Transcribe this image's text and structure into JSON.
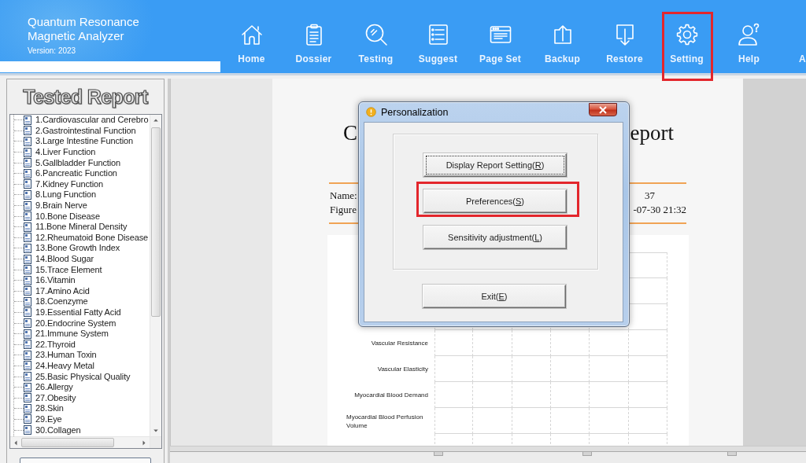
{
  "app": {
    "title_line_1": "Quantum Resonance",
    "title_line_2": "Magnetic Analyzer",
    "version": "Version: 2023"
  },
  "toolbar": [
    {
      "label": "Home",
      "highlighted": false
    },
    {
      "label": "Dossier",
      "highlighted": false
    },
    {
      "label": "Testing",
      "highlighted": false
    },
    {
      "label": "Suggest",
      "highlighted": false
    },
    {
      "label": "Page Set",
      "highlighted": false
    },
    {
      "label": "Backup",
      "highlighted": false
    },
    {
      "label": "Restore",
      "highlighted": false
    },
    {
      "label": "Setting",
      "highlighted": true
    },
    {
      "label": "Help",
      "highlighted": false
    },
    {
      "label": "A",
      "highlighted": false
    }
  ],
  "sidebar": {
    "heading": "Tested Report",
    "items": [
      {
        "label": "1.Cardiovascular and Cerebro",
        "selected": false
      },
      {
        "label": "2.Gastrointestinal Function",
        "selected": false
      },
      {
        "label": "3.Large Intestine Function",
        "selected": false
      },
      {
        "label": "4.Liver Function",
        "selected": false
      },
      {
        "label": "5.Gallbladder Function",
        "selected": false
      },
      {
        "label": "6.Pancreatic Function",
        "selected": false
      },
      {
        "label": "7.Kidney Function",
        "selected": false
      },
      {
        "label": "8.Lung Function",
        "selected": false
      },
      {
        "label": "9.Brain Nerve",
        "selected": false
      },
      {
        "label": "10.Bone Disease",
        "selected": false
      },
      {
        "label": "11.Bone Mineral Density",
        "selected": false
      },
      {
        "label": "12.Rheumatoid Bone Disease",
        "selected": false
      },
      {
        "label": "13.Bone Growth Index",
        "selected": false
      },
      {
        "label": "14.Blood Sugar",
        "selected": false
      },
      {
        "label": "15.Trace Element",
        "selected": false
      },
      {
        "label": "16.Vitamin",
        "selected": false
      },
      {
        "label": "17.Amino Acid",
        "selected": false
      },
      {
        "label": "18.Coenzyme",
        "selected": false
      },
      {
        "label": "19.Essential Fatty Acid",
        "selected": false
      },
      {
        "label": "20.Endocrine System",
        "selected": false
      },
      {
        "label": "21.Immune System",
        "selected": false
      },
      {
        "label": "22.Thyroid",
        "selected": false
      },
      {
        "label": "23.Human Toxin",
        "selected": false
      },
      {
        "label": "24.Heavy Metal",
        "selected": false
      },
      {
        "label": "25.Basic Physical Quality",
        "selected": false
      },
      {
        "label": "26.Allergy",
        "selected": false
      },
      {
        "label": "27.Obesity",
        "selected": false
      },
      {
        "label": "28.Skin",
        "selected": false
      },
      {
        "label": "29.Eye",
        "selected": false
      },
      {
        "label": "30.Collagen",
        "selected": false
      }
    ]
  },
  "report": {
    "title_line_2_start": "C",
    "title_line_2_end": "eport",
    "info": [
      {
        "label": "Name:",
        "value_end": "37"
      },
      {
        "label": "Figure",
        "value_end": "-07-30 21:32"
      }
    ],
    "rows": [
      {
        "label": "Vascular Resistance"
      },
      {
        "label": "Vascular Elasticity"
      },
      {
        "label": "Myocardial Blood Demand"
      },
      {
        "label": "Myocardial Blood Perfusion Volume"
      }
    ]
  },
  "dialog": {
    "title": "Personalization",
    "options": [
      {
        "label": "Display Report Setting(",
        "access_key": "R",
        "label_end": ")",
        "focused": true,
        "highlighted": false
      },
      {
        "label": "Preferences(",
        "access_key": "S",
        "label_end": ")",
        "focused": false,
        "highlighted": true
      },
      {
        "label": "Sensitivity adjustment(",
        "access_key": "L",
        "label_end": ")",
        "focused": false,
        "highlighted": false
      }
    ],
    "exit_button": {
      "label": "Exit(",
      "access_key": "E",
      "label_end": ")"
    }
  }
}
